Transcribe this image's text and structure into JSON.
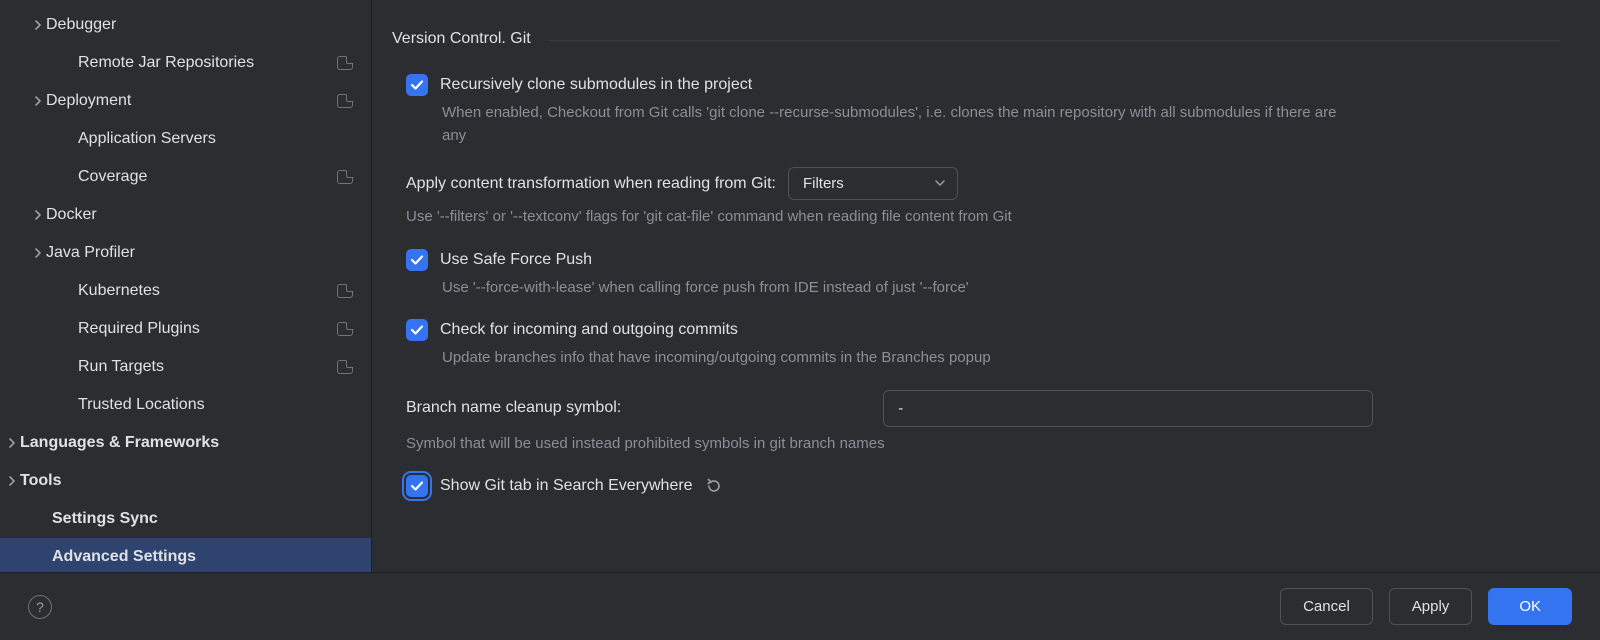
{
  "sidebar": {
    "items": [
      {
        "label": "Debugger",
        "indent": 46,
        "chevron": true,
        "badge": false,
        "bold": false,
        "selected": false
      },
      {
        "label": "Remote Jar Repositories",
        "indent": 62,
        "chevron": false,
        "badge": true,
        "bold": false,
        "selected": false
      },
      {
        "label": "Deployment",
        "indent": 46,
        "chevron": true,
        "badge": true,
        "bold": false,
        "selected": false
      },
      {
        "label": "Application Servers",
        "indent": 62,
        "chevron": false,
        "badge": false,
        "bold": false,
        "selected": false
      },
      {
        "label": "Coverage",
        "indent": 62,
        "chevron": false,
        "badge": true,
        "bold": false,
        "selected": false
      },
      {
        "label": "Docker",
        "indent": 46,
        "chevron": true,
        "badge": false,
        "bold": false,
        "selected": false
      },
      {
        "label": "Java Profiler",
        "indent": 46,
        "chevron": true,
        "badge": false,
        "bold": false,
        "selected": false
      },
      {
        "label": "Kubernetes",
        "indent": 62,
        "chevron": false,
        "badge": true,
        "bold": false,
        "selected": false
      },
      {
        "label": "Required Plugins",
        "indent": 62,
        "chevron": false,
        "badge": true,
        "bold": false,
        "selected": false
      },
      {
        "label": "Run Targets",
        "indent": 62,
        "chevron": false,
        "badge": true,
        "bold": false,
        "selected": false
      },
      {
        "label": "Trusted Locations",
        "indent": 62,
        "chevron": false,
        "badge": false,
        "bold": false,
        "selected": false
      },
      {
        "label": "Languages & Frameworks",
        "indent": 20,
        "chevron": true,
        "badge": false,
        "bold": true,
        "selected": false
      },
      {
        "label": "Tools",
        "indent": 20,
        "chevron": true,
        "badge": false,
        "bold": true,
        "selected": false
      },
      {
        "label": "Settings Sync",
        "indent": 36,
        "chevron": false,
        "badge": false,
        "bold": true,
        "selected": false
      },
      {
        "label": "Advanced Settings",
        "indent": 36,
        "chevron": false,
        "badge": false,
        "bold": true,
        "selected": true
      }
    ]
  },
  "content": {
    "section_title": "Version Control. Git",
    "settings": {
      "recursive_clone": {
        "label": "Recursively clone submodules in the project",
        "desc": "When enabled, Checkout from Git calls 'git clone --recurse-submodules', i.e. clones the main repository with all submodules if there are any",
        "checked": true
      },
      "content_transform": {
        "label": "Apply content transformation when reading from Git:",
        "value": "Filters",
        "desc": "Use '--filters' or '--textconv' flags for 'git cat-file' command when reading file content from Git"
      },
      "safe_force_push": {
        "label": "Use Safe Force Push",
        "desc": "Use '--force-with-lease' when calling force push from IDE instead of just '--force'",
        "checked": true
      },
      "check_commits": {
        "label": "Check for incoming and outgoing commits",
        "desc": "Update branches info that have incoming/outgoing commits in the Branches popup",
        "checked": true
      },
      "branch_cleanup": {
        "label": "Branch name cleanup symbol:",
        "value": "-",
        "desc": "Symbol that will be used instead prohibited symbols in git branch names"
      },
      "git_tab_search": {
        "label": "Show Git tab in Search Everywhere",
        "checked": true,
        "focused": true
      }
    }
  },
  "footer": {
    "cancel": "Cancel",
    "apply": "Apply",
    "ok": "OK"
  }
}
